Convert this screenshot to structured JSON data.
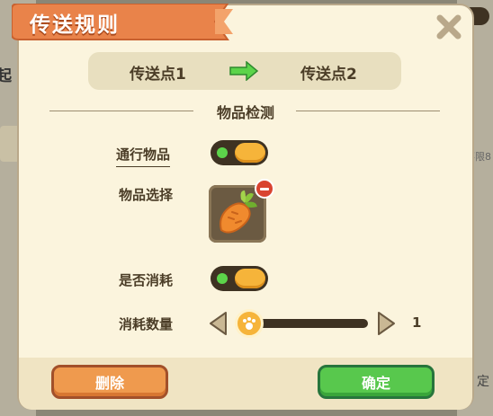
{
  "dialog": {
    "title": "传送规则",
    "close_icon": "close-x-icon"
  },
  "route": {
    "from": "传送点1",
    "to": "传送点2",
    "arrow_icon": "green-arrow-right-icon"
  },
  "section": {
    "title": "物品检测"
  },
  "rows": {
    "pass_item_label": "通行物品",
    "pass_item_toggle": true,
    "item_select_label": "物品选择",
    "item_icon": "carrot-icon",
    "consume_label": "是否消耗",
    "consume_toggle": true,
    "consume_count_label": "消耗数量",
    "consume_count_value": "1"
  },
  "buttons": {
    "delete": "删除",
    "confirm": "确定"
  },
  "background": {
    "partial_text_left": "起",
    "partial_text_right": "不限8",
    "partial_text_bottom_right": "定"
  },
  "colors": {
    "title_ribbon": "#e9834a",
    "panel": "#fbf4dd",
    "toggle_knob": "#f6b43a",
    "toggle_on_dot": "#5cd44a",
    "delete_button": "#ef9a4e",
    "confirm_button": "#58c84d"
  }
}
